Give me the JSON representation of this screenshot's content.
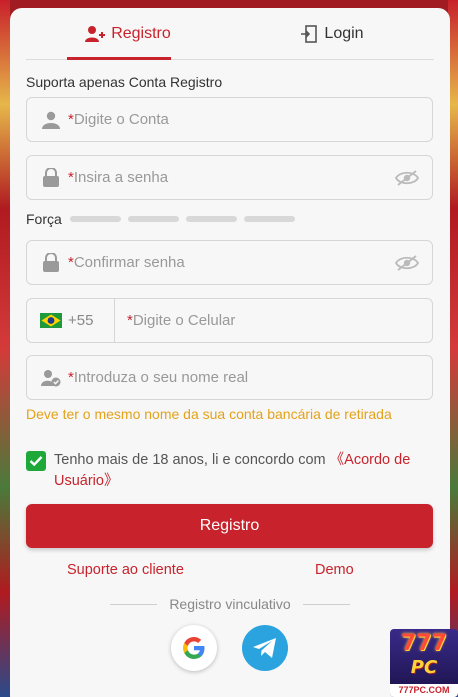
{
  "tabs": [
    {
      "label": "Registro",
      "icon": "add-user-icon",
      "active": true
    },
    {
      "label": "Login",
      "icon": "login-door-icon",
      "active": false
    }
  ],
  "hint": "Suporta apenas Conta Registro",
  "fields": {
    "account": {
      "required_mark": "*",
      "placeholder": "Digite o Conta",
      "icon": "user-icon"
    },
    "password": {
      "required_mark": "*",
      "placeholder": "Insira a senha",
      "icon": "lock-icon"
    },
    "strength_label": "Força",
    "confirm": {
      "required_mark": "*",
      "placeholder": "Confirmar senha",
      "icon": "lock-icon"
    },
    "phone": {
      "country_code": "+55",
      "flag": "brazil-flag-icon",
      "required_mark": "*",
      "placeholder": "Digite o Celular"
    },
    "realname": {
      "required_mark": "*",
      "placeholder": "Introduza o seu nome real",
      "icon": "user-verified-icon"
    }
  },
  "realname_note": "Deve ter o mesmo nome da sua conta bancária de retirada",
  "agreement": {
    "checked": true,
    "text": "Tenho mais de 18 anos, li e concordo com ",
    "link": "《Acordo de Usuário》"
  },
  "submit_label": "Registro",
  "links": {
    "support": "Suporte ao cliente",
    "demo": "Demo"
  },
  "divider_label": "Registro vinculativo",
  "social": [
    "google-icon",
    "telegram-icon"
  ],
  "brand": {
    "logo_digits": "777",
    "logo_text": "PC",
    "domain": "777PC.COM"
  },
  "colors": {
    "accent": "#c8232c",
    "warning": "#e3a21a",
    "check": "#1ea83a"
  }
}
